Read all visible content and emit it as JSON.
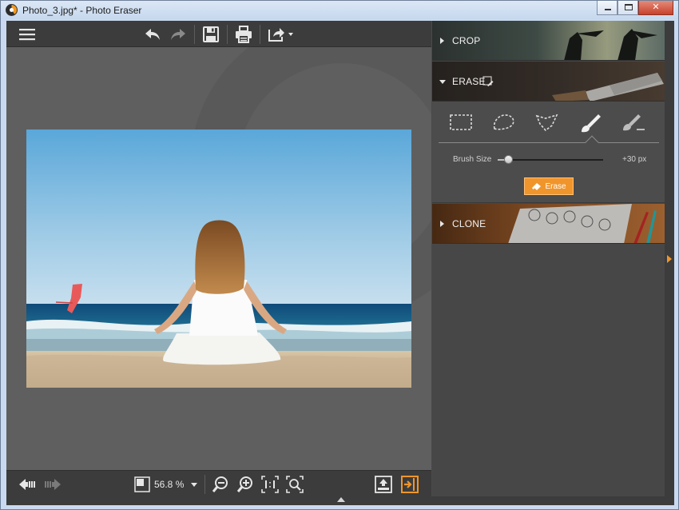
{
  "window": {
    "title": "Photo_3.jpg* - Photo Eraser",
    "min_label": "minimize",
    "max_label": "maximize",
    "close_label": "close"
  },
  "toolbar": {
    "icons": [
      "menu-icon",
      "undo-icon",
      "redo-icon",
      "save-icon",
      "print-icon",
      "export-icon"
    ]
  },
  "panel": {
    "crop_label": "CROP",
    "erase_label": "ERASE",
    "clone_label": "CLONE",
    "tools": [
      "rect-select-icon",
      "lasso-select-icon",
      "polygon-select-icon",
      "brush-icon",
      "brush-minus-icon"
    ],
    "active_tool": "brush-icon",
    "brush_size_label": "Brush Size",
    "brush_size_value": "+30 px",
    "brush_size_level": 0.1,
    "erase_button_label": "Erase"
  },
  "statusbar": {
    "zoom_value": "56.8 %"
  },
  "colors": {
    "accent": "#f0952b",
    "dark_bar": "#3c3c3c",
    "canvas": "#5f5f5f"
  }
}
